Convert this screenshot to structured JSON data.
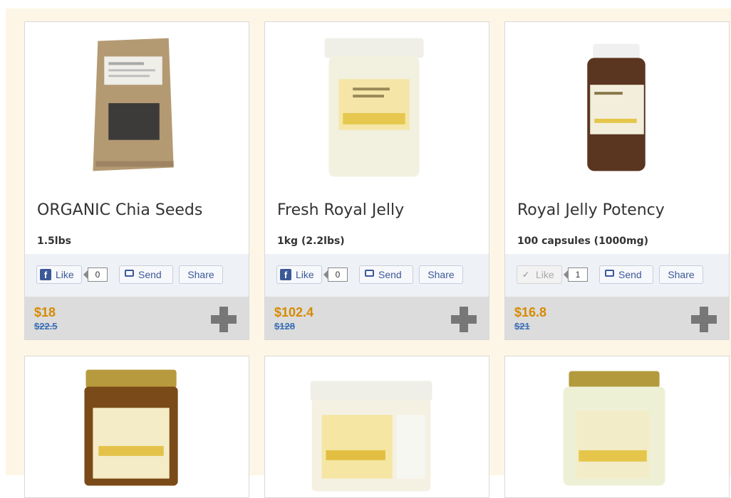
{
  "products": [
    {
      "title": "ORGANIC Chia Seeds",
      "qty": "1.5lbs",
      "like": "Like",
      "like_count": "0",
      "send": "Send",
      "share": "Share",
      "price": "$18",
      "old_price": "$22.5"
    },
    {
      "title": "Fresh Royal Jelly",
      "qty": "1kg (2.2lbs)",
      "like": "Like",
      "like_count": "0",
      "send": "Send",
      "share": "Share",
      "price": "$102.4",
      "old_price": "$128"
    },
    {
      "title": "Royal Jelly Potency",
      "qty": "100 capsules (1000mg)",
      "like": "Like",
      "like_count": "1",
      "send": "Send",
      "share": "Share",
      "price": "$16.8",
      "old_price": "$21"
    }
  ],
  "colors": {
    "page_bg": "#fdf6e6",
    "price": "#d68a00",
    "old_price": "#3b6fb5",
    "facebook": "#3b5998"
  }
}
